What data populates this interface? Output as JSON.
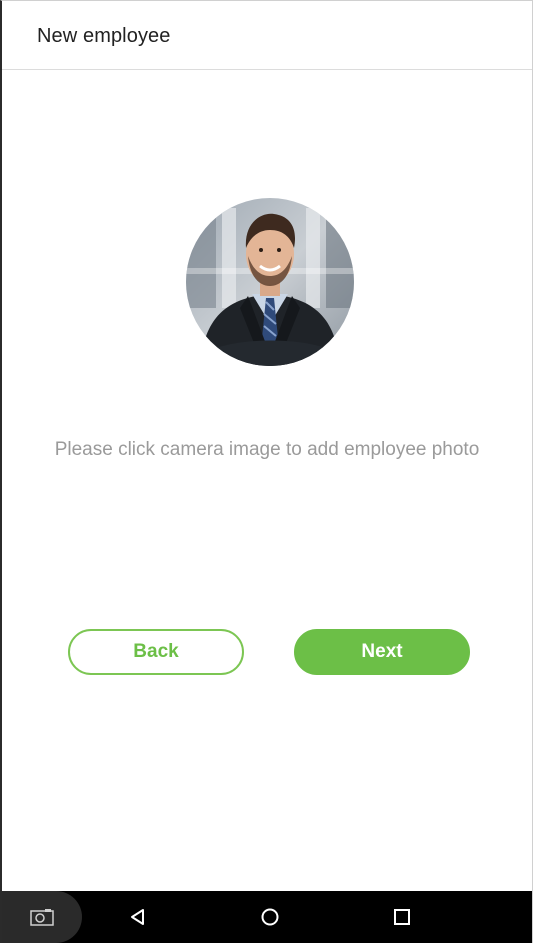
{
  "header": {
    "title": "New employee"
  },
  "photo": {
    "icon": "employee-photo"
  },
  "hint": {
    "text": "Please click camera image to add employee photo"
  },
  "buttons": {
    "back_label": "Back",
    "next_label": "Next"
  },
  "colors": {
    "accent": "#6cbf47",
    "hint_text": "#9a9a9a",
    "nav_bar": "#000000"
  },
  "nav_bar": {
    "icons": [
      "camera-icon",
      "back-triangle-icon",
      "home-circle-icon",
      "recents-square-icon"
    ]
  }
}
